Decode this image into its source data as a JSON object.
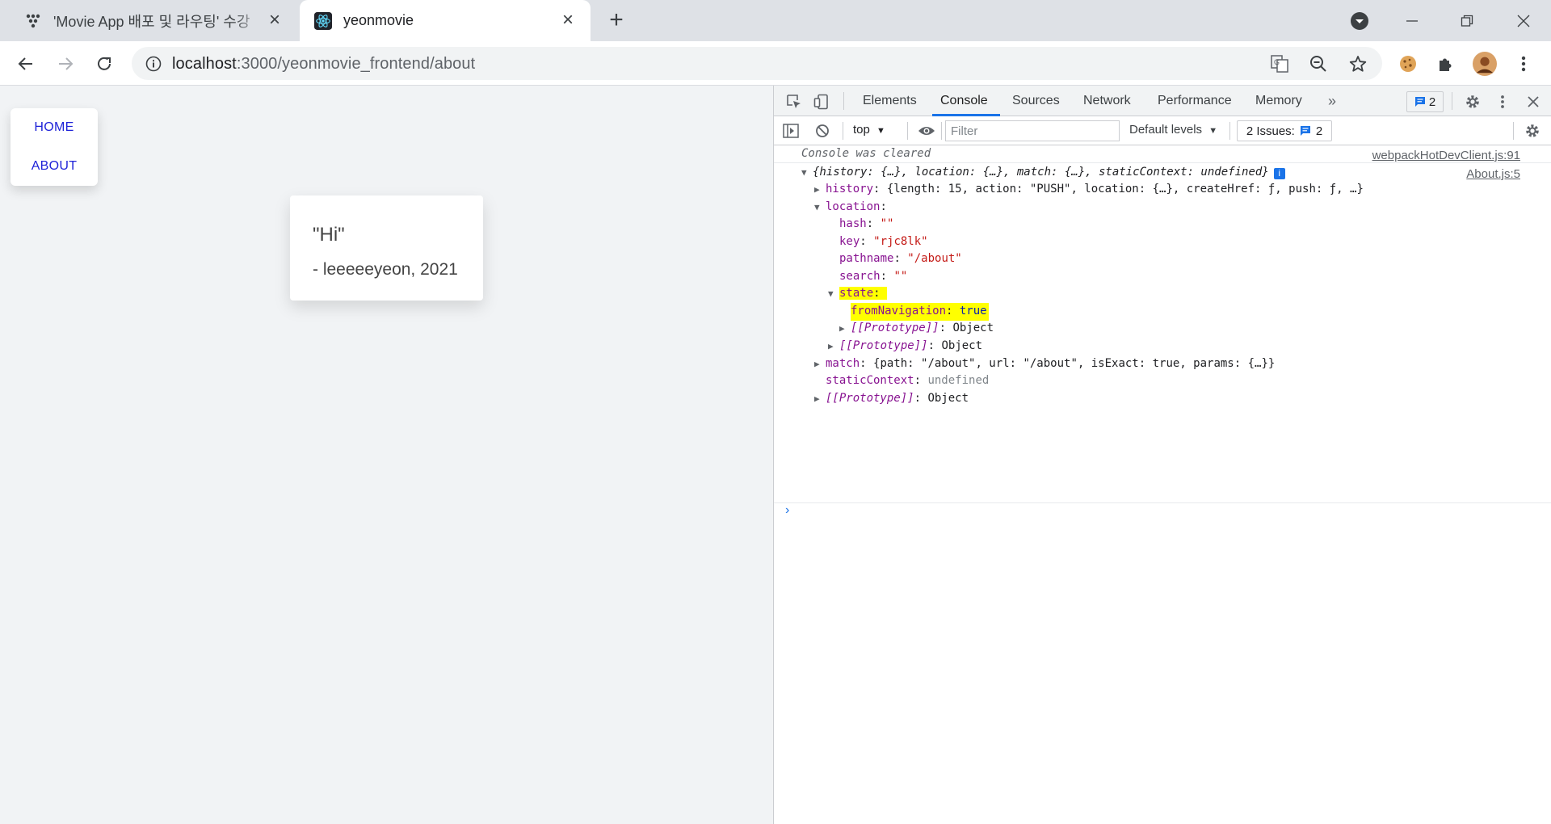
{
  "browser": {
    "tabs": [
      {
        "title": "'Movie App 배포 및 라우팅' 수강",
        "active": false
      },
      {
        "title": "yeonmovie",
        "active": true
      }
    ],
    "url_host": "localhost",
    "url_path": ":3000/yeonmovie_frontend/about"
  },
  "page": {
    "nav": {
      "home": "HOME",
      "about": "ABOUT"
    },
    "card": {
      "quote": "\"Hi\"",
      "author": "- leeeeeyeon, 2021"
    }
  },
  "devtools": {
    "tabs": [
      "Elements",
      "Console",
      "Sources",
      "Network",
      "Performance",
      "Memory"
    ],
    "active_tab": "Console",
    "message_count": "2",
    "context": "top",
    "filter_placeholder": "Filter",
    "levels": "Default levels",
    "issues_label": "2 Issues:",
    "issues_count": "2",
    "console": {
      "cleared": "Console was cleared",
      "cleared_src": "webpackHotDevClient.js:91",
      "log_src": "About.js:5",
      "summary": "{history: {…}, location: {…}, match: {…}, staticContext: undefined}",
      "history_line": "{length: 15, action: \"PUSH\", location: {…}, createHref: ƒ, push: ƒ, …}",
      "location_label": "location",
      "hash": "\"\"",
      "key": "\"rjc8lk\"",
      "pathname": "\"/about\"",
      "search": "\"\"",
      "state_label": "state",
      "fromNavigation": "true",
      "prototype_label": "[[Prototype]]",
      "prototype_value": "Object",
      "match_line": "{path: \"/about\", url: \"/about\", isExact: true, params: {…}}",
      "staticContext": "undefined"
    }
  },
  "colors": {
    "accent": "#1a73e8",
    "highlight": "#ffff00",
    "nav_link": "#1f23d8"
  }
}
